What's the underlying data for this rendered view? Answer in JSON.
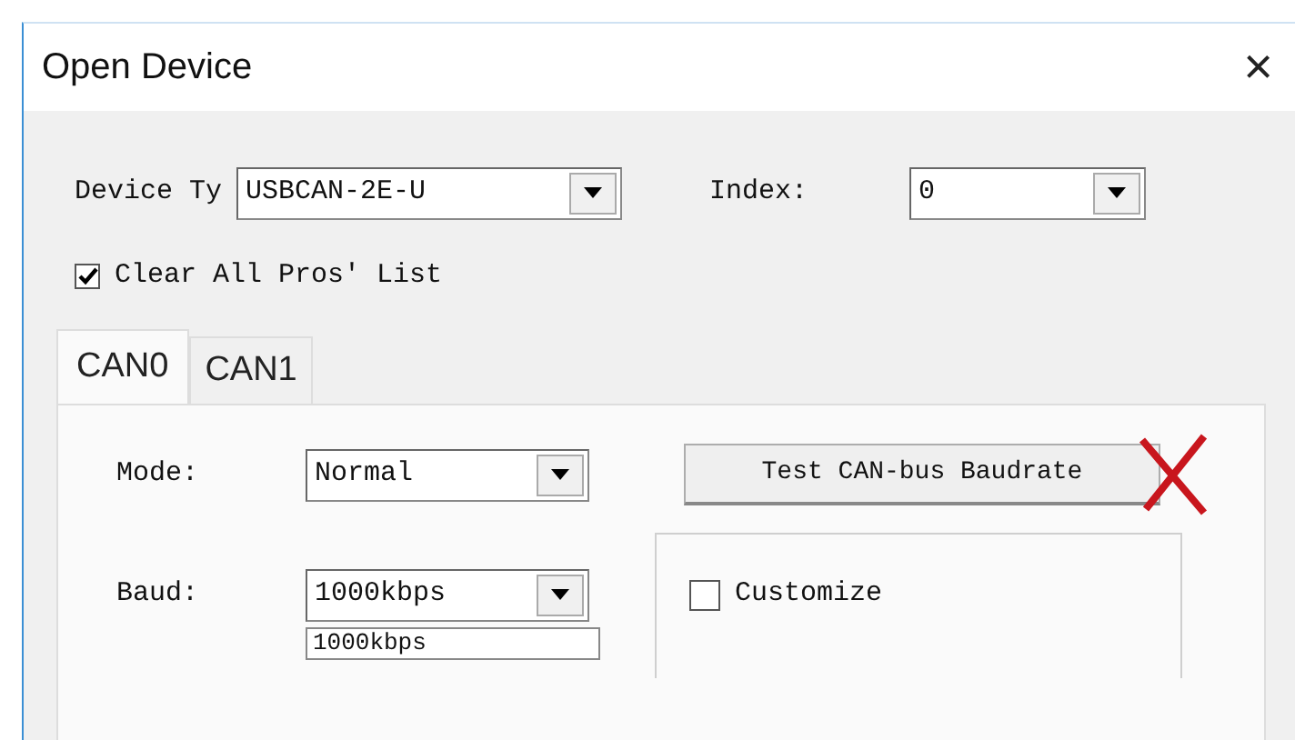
{
  "window": {
    "title": "Open Device",
    "close": "×"
  },
  "device": {
    "label": "Device Ty",
    "value": "USBCAN-2E-U"
  },
  "index": {
    "label": "Index:",
    "value": "0"
  },
  "clear_list": {
    "label": "Clear All Pros' List",
    "checked": true
  },
  "tabs": [
    {
      "label": "CAN0",
      "selected": true
    },
    {
      "label": "CAN1",
      "selected": false
    }
  ],
  "mode": {
    "label": "Mode:",
    "value": "Normal"
  },
  "test_button": "Test CAN-bus Baudrate",
  "baud": {
    "label": "Baud:",
    "value": "1000kbps",
    "list_item": "1000kbps"
  },
  "customize": {
    "label": "Customize",
    "checked": false
  }
}
